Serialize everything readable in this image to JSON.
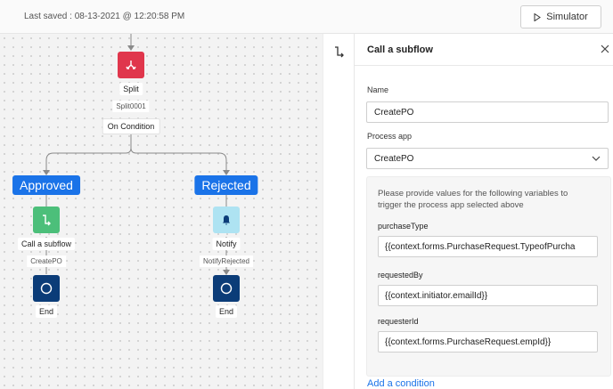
{
  "header": {
    "last_saved": "Last saved : 08-13-2021 @ 12:20:58 PM",
    "simulator_label": "Simulator"
  },
  "canvas": {
    "split_label": "Split",
    "split_id": "Split0001",
    "condition_label": "On Condition",
    "branches": {
      "approved": "Approved",
      "rejected": "Rejected"
    },
    "subflow_label": "Call a subflow",
    "subflow_id": "CreatePO",
    "notify_label": "Notify",
    "notify_id": "NotifyRejected",
    "end_label": "End",
    "end_label_2": "End"
  },
  "panel": {
    "title": "Call a subflow",
    "name_label": "Name",
    "name_value": "CreatePO",
    "process_app_label": "Process app",
    "process_app_value": "CreatePO",
    "instructions": "Please provide values for the following variables to trigger the process app selected above",
    "variables": [
      {
        "label": "purchaseType",
        "value": "{{context.forms.PurchaseRequest.TypeofPurcha"
      },
      {
        "label": "requestedBy",
        "value": "{{context.initiator.emailId}}"
      },
      {
        "label": "requesterId",
        "value": "{{context.forms.PurchaseRequest.empId}}"
      }
    ],
    "add_condition": "Add a condition"
  },
  "colors": {
    "accent": "#1a73e8",
    "split_node": "#e0364c",
    "subflow_node": "#4cbf7a",
    "notify_node": "#aee3f2",
    "end_node": "#0b3c78"
  }
}
